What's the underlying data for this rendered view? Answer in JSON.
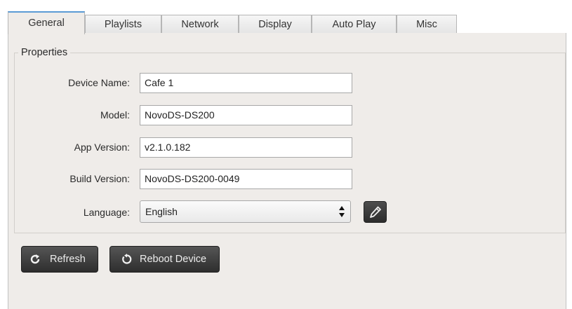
{
  "tabs": [
    {
      "label": "General",
      "active": true
    },
    {
      "label": "Playlists",
      "active": false
    },
    {
      "label": "Network",
      "active": false
    },
    {
      "label": "Display",
      "active": false
    },
    {
      "label": "Auto Play",
      "active": false
    },
    {
      "label": "Misc",
      "active": false
    }
  ],
  "properties": {
    "title": "Properties",
    "device_name": {
      "label": "Device Name:",
      "value": "Cafe 1"
    },
    "model": {
      "label": "Model:",
      "value": "NovoDS-DS200"
    },
    "app_version": {
      "label": "App Version:",
      "value": "v2.1.0.182"
    },
    "build_version": {
      "label": "Build Version:",
      "value": "NovoDS-DS200-0049"
    },
    "language": {
      "label": "Language:",
      "value": "English"
    }
  },
  "actions": {
    "refresh_label": "Refresh",
    "reboot_label": "Reboot Device"
  },
  "icons": {
    "edit": "pencil-icon",
    "refresh": "refresh-icon",
    "reboot": "reboot-icon",
    "select_arrows": "updown-arrows-icon"
  },
  "colors": {
    "panel_bg": "#efece9",
    "active_tab_accent": "#5b9bd5",
    "dark_button": "#3a3a3a"
  }
}
